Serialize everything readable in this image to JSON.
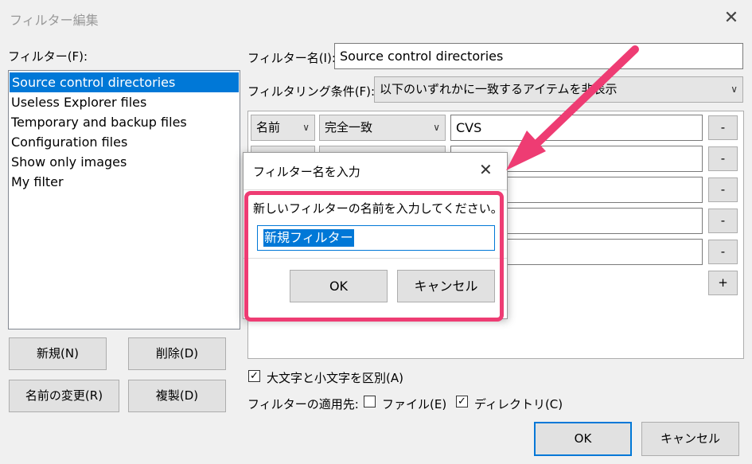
{
  "window": {
    "title": "フィルター編集"
  },
  "left": {
    "filters_label": "フィルター(F):",
    "filters": [
      "Source control directories",
      "Useless Explorer files",
      "Temporary and backup files",
      "Configuration files",
      "Show only images",
      "My filter"
    ],
    "buttons": {
      "new": "新規(N)",
      "delete": "削除(D)",
      "rename": "名前の変更(R)",
      "duplicate": "複製(D)"
    }
  },
  "right": {
    "name_label": "フィルター名(I):",
    "name_value": "Source control directories",
    "condition_label": "フィルタリング条件(F):",
    "condition_value": "以下のいずれかに一致するアイテムを非表示",
    "rule1": {
      "field": "名前",
      "match": "完全一致",
      "value": "CVS"
    },
    "remove_label": "-",
    "add_label": "+",
    "case_label": "大文字と小文字を区別(A)",
    "apply_label": "フィルターの適用先:",
    "files_label": "ファイル(E)",
    "dirs_label": "ディレクトリ(C)",
    "ok_label": "OK",
    "cancel_label": "キャンセル"
  },
  "dialog": {
    "title": "フィルター名を入力",
    "prompt": "新しいフィルターの名前を入力してください。",
    "input_value": "新規フィルター",
    "ok_label": "OK",
    "cancel_label": "キャンセル"
  },
  "colors": {
    "highlight": "#ee3c73",
    "selection": "#0078d7",
    "ok_border": "#0078d7"
  }
}
